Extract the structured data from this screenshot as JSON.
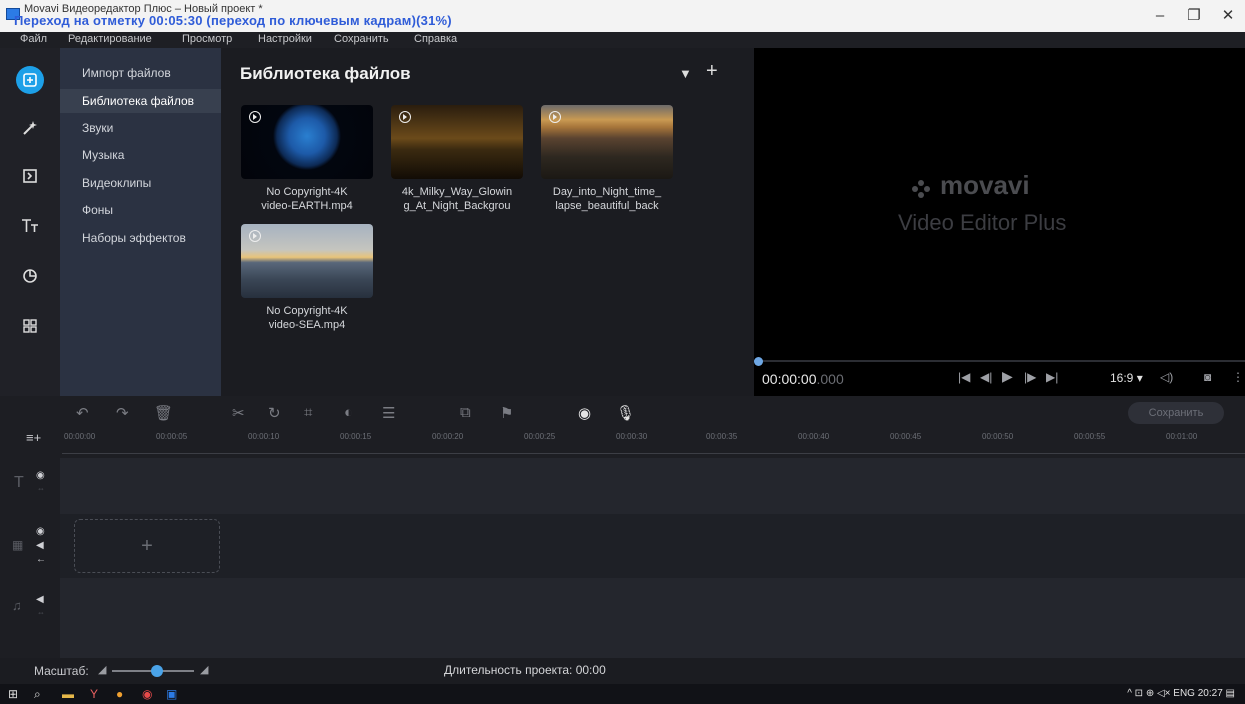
{
  "window": {
    "title": "Movavi Видеоредактор Плюс – Новый проект *",
    "overlay": "Переход на отметку 00:05:30 (переход по ключевым кадрам)(31%)",
    "controls": [
      "–",
      "❐",
      "✕"
    ]
  },
  "menu": [
    "Файл",
    "Редактирование",
    "Просмотр",
    "Настройки",
    "Сохранить",
    "Справка"
  ],
  "rail_icons": [
    "import-icon",
    "magic-wand-icon",
    "transitions-icon",
    "titles-icon",
    "stickers-icon",
    "more-tools-icon"
  ],
  "categories": [
    {
      "label": "Импорт файлов"
    },
    {
      "label": "Библиотека файлов"
    },
    {
      "label": "Звуки"
    },
    {
      "label": "Музыка"
    },
    {
      "label": "Видеоклипы"
    },
    {
      "label": "Фоны"
    },
    {
      "label": "Наборы эффектов"
    }
  ],
  "selected_category": "Библиотека файлов",
  "library": {
    "title": "Библиотека файлов",
    "filter_glyph": "▼",
    "add_glyph": "+",
    "clips": [
      {
        "label": "No Copyright-4K\nvideo-EARTH.mp4"
      },
      {
        "label": "4k_Milky_Way_Glowin\ng_At_Night_Backgrou"
      },
      {
        "label": "Day_into_Night_time_\nlapse_beautiful_back"
      },
      {
        "label": "No Copyright-4K\nvideo-SEA.mp4"
      }
    ]
  },
  "preview": {
    "logo": "movavi",
    "subtitle": "Video Editor Plus",
    "timecode": "00:00:00",
    "timecode_ms": ".000",
    "aspect": "16:9 ▾",
    "progress": 0
  },
  "timeline": {
    "save_label": "Сохранить",
    "ticks": [
      "00:00:00",
      "00:00:05",
      "00:00:10",
      "00:00:15",
      "00:00:20",
      "00:00:25",
      "00:00:30",
      "00:00:35",
      "00:00:40",
      "00:00:45",
      "00:00:50",
      "00:00:55",
      "00:01:00"
    ],
    "drop_glyph": "+"
  },
  "footer": {
    "zoom_label": "Масштаб:",
    "zoom_level": 0.55,
    "duration": "Длительность проекта: 00:00"
  },
  "taskbar": {
    "tray": "^ ⊡ ⊕ ◁× ENG 20:27",
    "notification_glyph": "▤"
  }
}
